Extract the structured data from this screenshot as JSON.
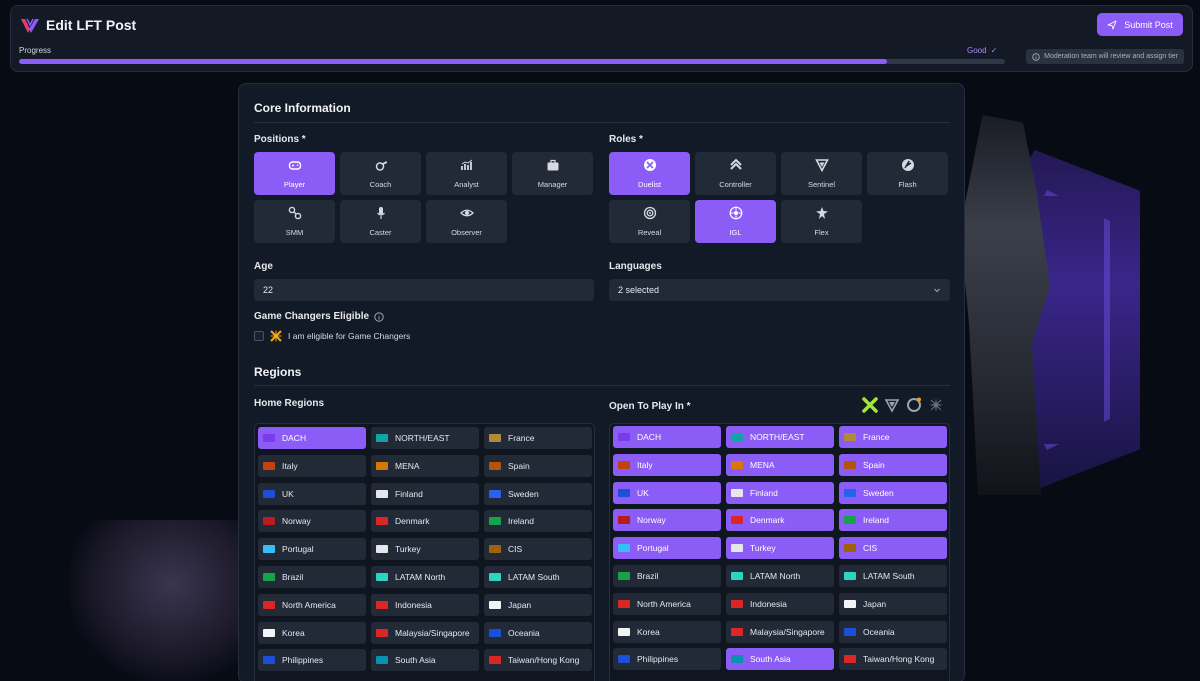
{
  "header": {
    "title": "Edit LFT Post",
    "submit_label": "Submit Post",
    "progress_label": "Progress",
    "progress_status": "Good",
    "progress_fraction": 0.88,
    "moderation_note": "Moderation team will review and assign tier",
    "accent": "#8b5cf6"
  },
  "core": {
    "title": "Core Information",
    "positions_label": "Positions *",
    "positions": [
      {
        "label": "Player",
        "icon": "gamepad-icon",
        "selected": true
      },
      {
        "label": "Coach",
        "icon": "whistle-icon",
        "selected": false
      },
      {
        "label": "Analyst",
        "icon": "chart-icon",
        "selected": false
      },
      {
        "label": "Manager",
        "icon": "briefcase-icon",
        "selected": false
      },
      {
        "label": "SMM",
        "icon": "share-icon",
        "selected": false
      },
      {
        "label": "Caster",
        "icon": "microphone-icon",
        "selected": false
      },
      {
        "label": "Observer",
        "icon": "eye-icon",
        "selected": false
      }
    ],
    "roles_label": "Roles *",
    "roles": [
      {
        "label": "Duelist",
        "icon": "duelist-icon",
        "selected": true
      },
      {
        "label": "Controller",
        "icon": "controller-icon",
        "selected": false
      },
      {
        "label": "Sentinel",
        "icon": "sentinel-icon",
        "selected": false
      },
      {
        "label": "Flash",
        "icon": "flash-icon",
        "selected": false
      },
      {
        "label": "Reveal",
        "icon": "reveal-icon",
        "selected": false
      },
      {
        "label": "IGL",
        "icon": "igl-icon",
        "selected": true
      },
      {
        "label": "Flex",
        "icon": "flex-icon",
        "selected": false
      }
    ],
    "age_label": "Age",
    "age_value": "22",
    "languages_label": "Languages",
    "languages_value": "2 selected",
    "gc_label": "Game Changers Eligible",
    "gc_checkbox_label": "I am eligible for Game Changers"
  },
  "regions": {
    "title": "Regions",
    "home_label": "Home Regions",
    "open_label": "Open To Play In *",
    "list": [
      {
        "name": "DACH",
        "color": "#7c3aed"
      },
      {
        "name": "NORTH/EAST",
        "color": "#0ea5a4"
      },
      {
        "name": "France",
        "color": "#b08a3c"
      },
      {
        "name": "Italy",
        "color": "#c2410c"
      },
      {
        "name": "MENA",
        "color": "#d97706"
      },
      {
        "name": "Spain",
        "color": "#b45309"
      },
      {
        "name": "UK",
        "color": "#1d4ed8"
      },
      {
        "name": "Finland",
        "color": "#e5e7eb"
      },
      {
        "name": "Sweden",
        "color": "#2563eb"
      },
      {
        "name": "Norway",
        "color": "#b91c1c"
      },
      {
        "name": "Denmark",
        "color": "#dc2626"
      },
      {
        "name": "Ireland",
        "color": "#16a34a"
      },
      {
        "name": "Portugal",
        "color": "#38bdf8"
      },
      {
        "name": "Turkey",
        "color": "#e5e7eb"
      },
      {
        "name": "CIS",
        "color": "#a16207"
      },
      {
        "name": "Brazil",
        "color": "#16a34a"
      },
      {
        "name": "LATAM North",
        "color": "#2dd4bf"
      },
      {
        "name": "LATAM South",
        "color": "#2dd4bf"
      },
      {
        "name": "North America",
        "color": "#dc2626"
      },
      {
        "name": "Indonesia",
        "color": "#dc2626"
      },
      {
        "name": "Japan",
        "color": "#f3f4f6"
      },
      {
        "name": "Korea",
        "color": "#f3f4f6"
      },
      {
        "name": "Malaysia/Singapore",
        "color": "#dc2626"
      },
      {
        "name": "Oceania",
        "color": "#1d4ed8"
      },
      {
        "name": "Philippines",
        "color": "#1d4ed8"
      },
      {
        "name": "South Asia",
        "color": "#0891b2"
      },
      {
        "name": "Taiwan/Hong Kong",
        "color": "#dc2626"
      }
    ],
    "home_selected": [
      "DACH"
    ],
    "open_selected": [
      "DACH",
      "NORTH/EAST",
      "France",
      "Italy",
      "MENA",
      "Spain",
      "UK",
      "Finland",
      "Sweden",
      "Norway",
      "Denmark",
      "Ireland",
      "Portugal",
      "Turkey",
      "CIS",
      "South Asia"
    ],
    "game_icons": [
      "valorant-x-icon",
      "riot-shield-icon",
      "overwatch-icon",
      "star-burst-icon"
    ]
  }
}
